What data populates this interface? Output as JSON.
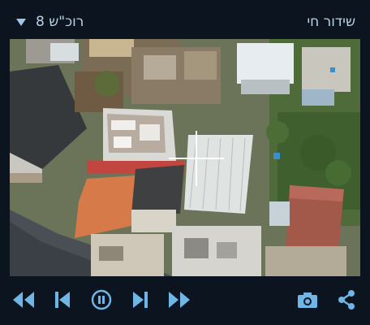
{
  "header": {
    "live_title": "שידור חי",
    "camera_label": "רוכ\"ש 8"
  },
  "video": {
    "description_icon": "crosshair-icon"
  },
  "controls": {
    "icons": [
      "rewind-icon",
      "previous-icon",
      "pause-icon",
      "next-icon",
      "fast-forward-icon",
      "camera-icon",
      "share-icon"
    ]
  },
  "colors": {
    "accent": "#6fb5e6",
    "text": "#b9d3e6",
    "background": "#0c1420"
  }
}
